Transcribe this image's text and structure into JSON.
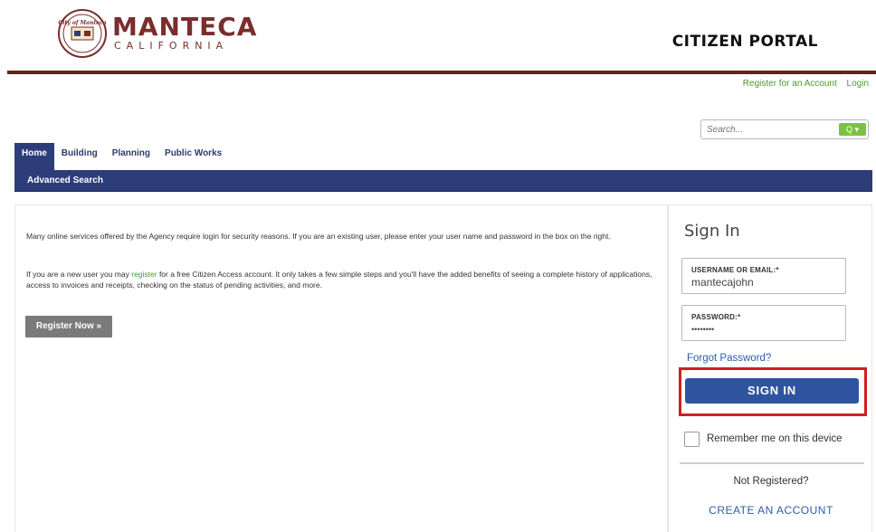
{
  "header": {
    "logo_script": "City of Manteca",
    "logo_main": "MANTECA",
    "logo_sub": "CALIFORNIA",
    "portal_title": "CITIZEN PORTAL"
  },
  "toplinks": {
    "register": "Register for an Account",
    "login": "Login"
  },
  "search": {
    "placeholder": "Search...",
    "button_label": "Q ▾"
  },
  "tabs": [
    {
      "label": "Home",
      "active": true
    },
    {
      "label": "Building",
      "active": false
    },
    {
      "label": "Planning",
      "active": false
    },
    {
      "label": "Public Works",
      "active": false
    }
  ],
  "subnav": {
    "advanced_search": "Advanced Search"
  },
  "main": {
    "para1": "Many online services offered by the Agency require login for security reasons. If you are an existing user, please enter your user name and password in the box on the right.",
    "para2_before": "If you are a new user you may ",
    "para2_link": "register",
    "para2_after": " for a free Citizen Access account. It only takes a few simple steps and you'll have the added benefits of seeing a complete history of applications, access to invoices and receipts, checking on the status of pending activities, and more.",
    "register_now": "Register Now »"
  },
  "signin": {
    "title": "Sign In",
    "username_label": "USERNAME OR EMAIL:*",
    "username_value": "mantecajohn",
    "password_label": "PASSWORD:*",
    "password_value": "••••••••",
    "forgot": "Forgot Password?",
    "button": "SIGN IN",
    "remember": "Remember me on this device",
    "not_registered": "Not Registered?",
    "create_account": "CREATE AN ACCOUNT"
  },
  "colors": {
    "brand_red": "#7a2d2d",
    "nav_blue": "#2d3d7a",
    "button_blue": "#2e54a0",
    "link_green": "#4a9a2c",
    "highlight_red": "#d01f1f"
  }
}
